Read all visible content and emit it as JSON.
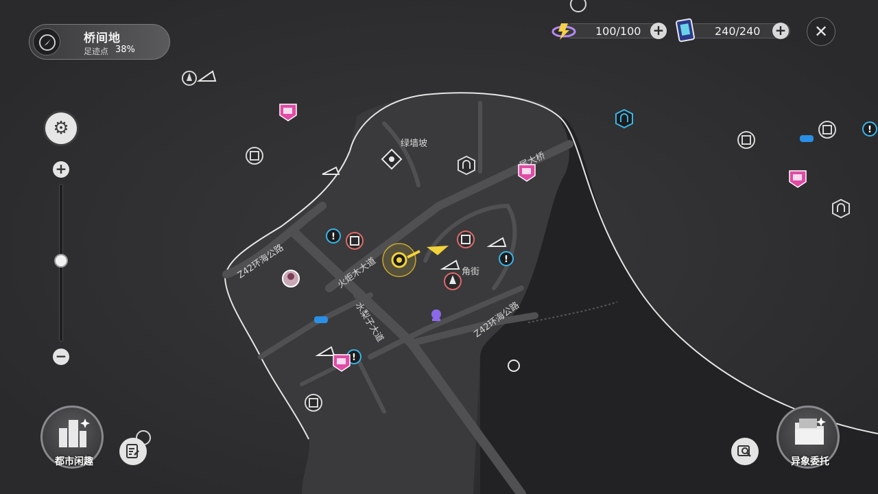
{
  "location": {
    "name": "桥间地",
    "progress_label": "足迹点",
    "progress_value": "38%"
  },
  "resources": [
    {
      "icon": "battery-energy-icon",
      "value": "100/100",
      "plus": "+"
    },
    {
      "icon": "card-ticket-icon",
      "value": "240/240",
      "plus": "+"
    }
  ],
  "close_glyph": "✕",
  "zoom": {
    "plus": "+",
    "minus": "−",
    "level": 0.5
  },
  "settings_glyph": "⚙",
  "map_labels": {
    "green_wall_slope": "绿墙坡",
    "bridge": "尾大桥",
    "corner_street": "角街",
    "z42_west": "Z42环海公路",
    "z42_east": "Z42环海公路",
    "torch_avenue": "火炬木大道",
    "pear_avenue": "水梨子大道"
  },
  "buttons": {
    "city": "都市闲趣",
    "commission": "异象委托"
  },
  "colors": {
    "sea": "#2b2b2d",
    "land": "#353537",
    "district": "#3c3c3e",
    "coast": "#e8e8e8",
    "road": "#4e4e51",
    "flag_pink": "#e14aa5",
    "quest_blue": "#38b6e8",
    "player_yellow": "#f2d23a"
  }
}
